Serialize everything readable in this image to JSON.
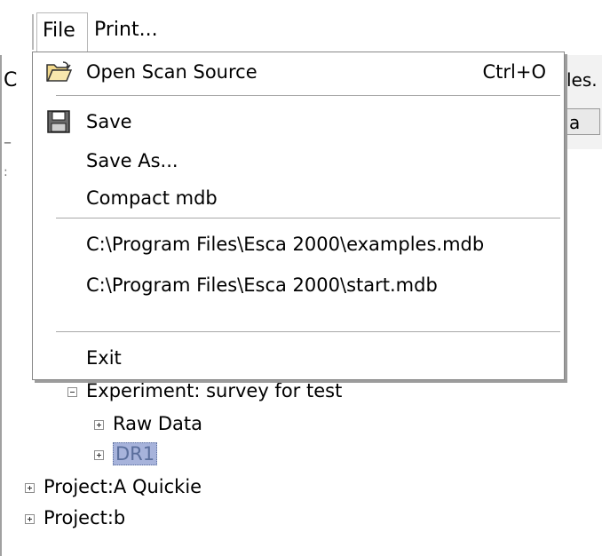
{
  "menubar": {
    "file_label": "File",
    "print_label": "Print..."
  },
  "background": {
    "peek_left": "C",
    "peek_right": "les.",
    "peek_button": "a"
  },
  "file_menu": {
    "items": [
      {
        "label": "Open Scan Source",
        "shortcut": "Ctrl+O",
        "icon": "open-folder-icon"
      },
      {
        "label": "Save",
        "icon": "floppy-disk-icon"
      },
      {
        "label": "Save As..."
      },
      {
        "label": "Compact mdb"
      },
      {
        "label": "C:\\Program Files\\Esca 2000\\examples.mdb"
      },
      {
        "label": "C:\\Program Files\\Esca 2000\\start.mdb"
      },
      {
        "label": "Exit"
      }
    ]
  },
  "tree": {
    "nodes": [
      {
        "label": "Experiment: survey for test",
        "expanded": true
      },
      {
        "label": "Raw Data",
        "expanded": false
      },
      {
        "label": "DR1",
        "expanded": false,
        "selected": true
      },
      {
        "label": "Project:A Quickie",
        "expanded": false
      },
      {
        "label": "Project:b",
        "expanded": false
      }
    ]
  },
  "colors": {
    "selection_bg": "#a7b3db",
    "menu_border": "#888888"
  }
}
